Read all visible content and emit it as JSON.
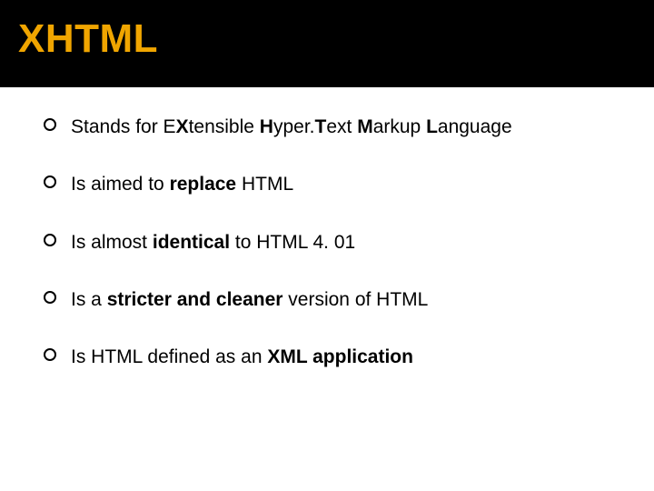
{
  "title": "XHTML",
  "bullets": [
    {
      "html": "Stands for E<b>X</b>tensible <b>H</b>yper.<b>T</b>ext <b>M</b>arkup <b>L</b>anguage"
    },
    {
      "html": "Is aimed to <b>replace</b> HTML"
    },
    {
      "html": "Is almost <b>identical</b> to HTML 4. 01"
    },
    {
      "html": "Is a <b>stricter and cleaner</b> version of HTML"
    },
    {
      "html": "Is HTML defined as an <b>XML application</b>"
    }
  ]
}
